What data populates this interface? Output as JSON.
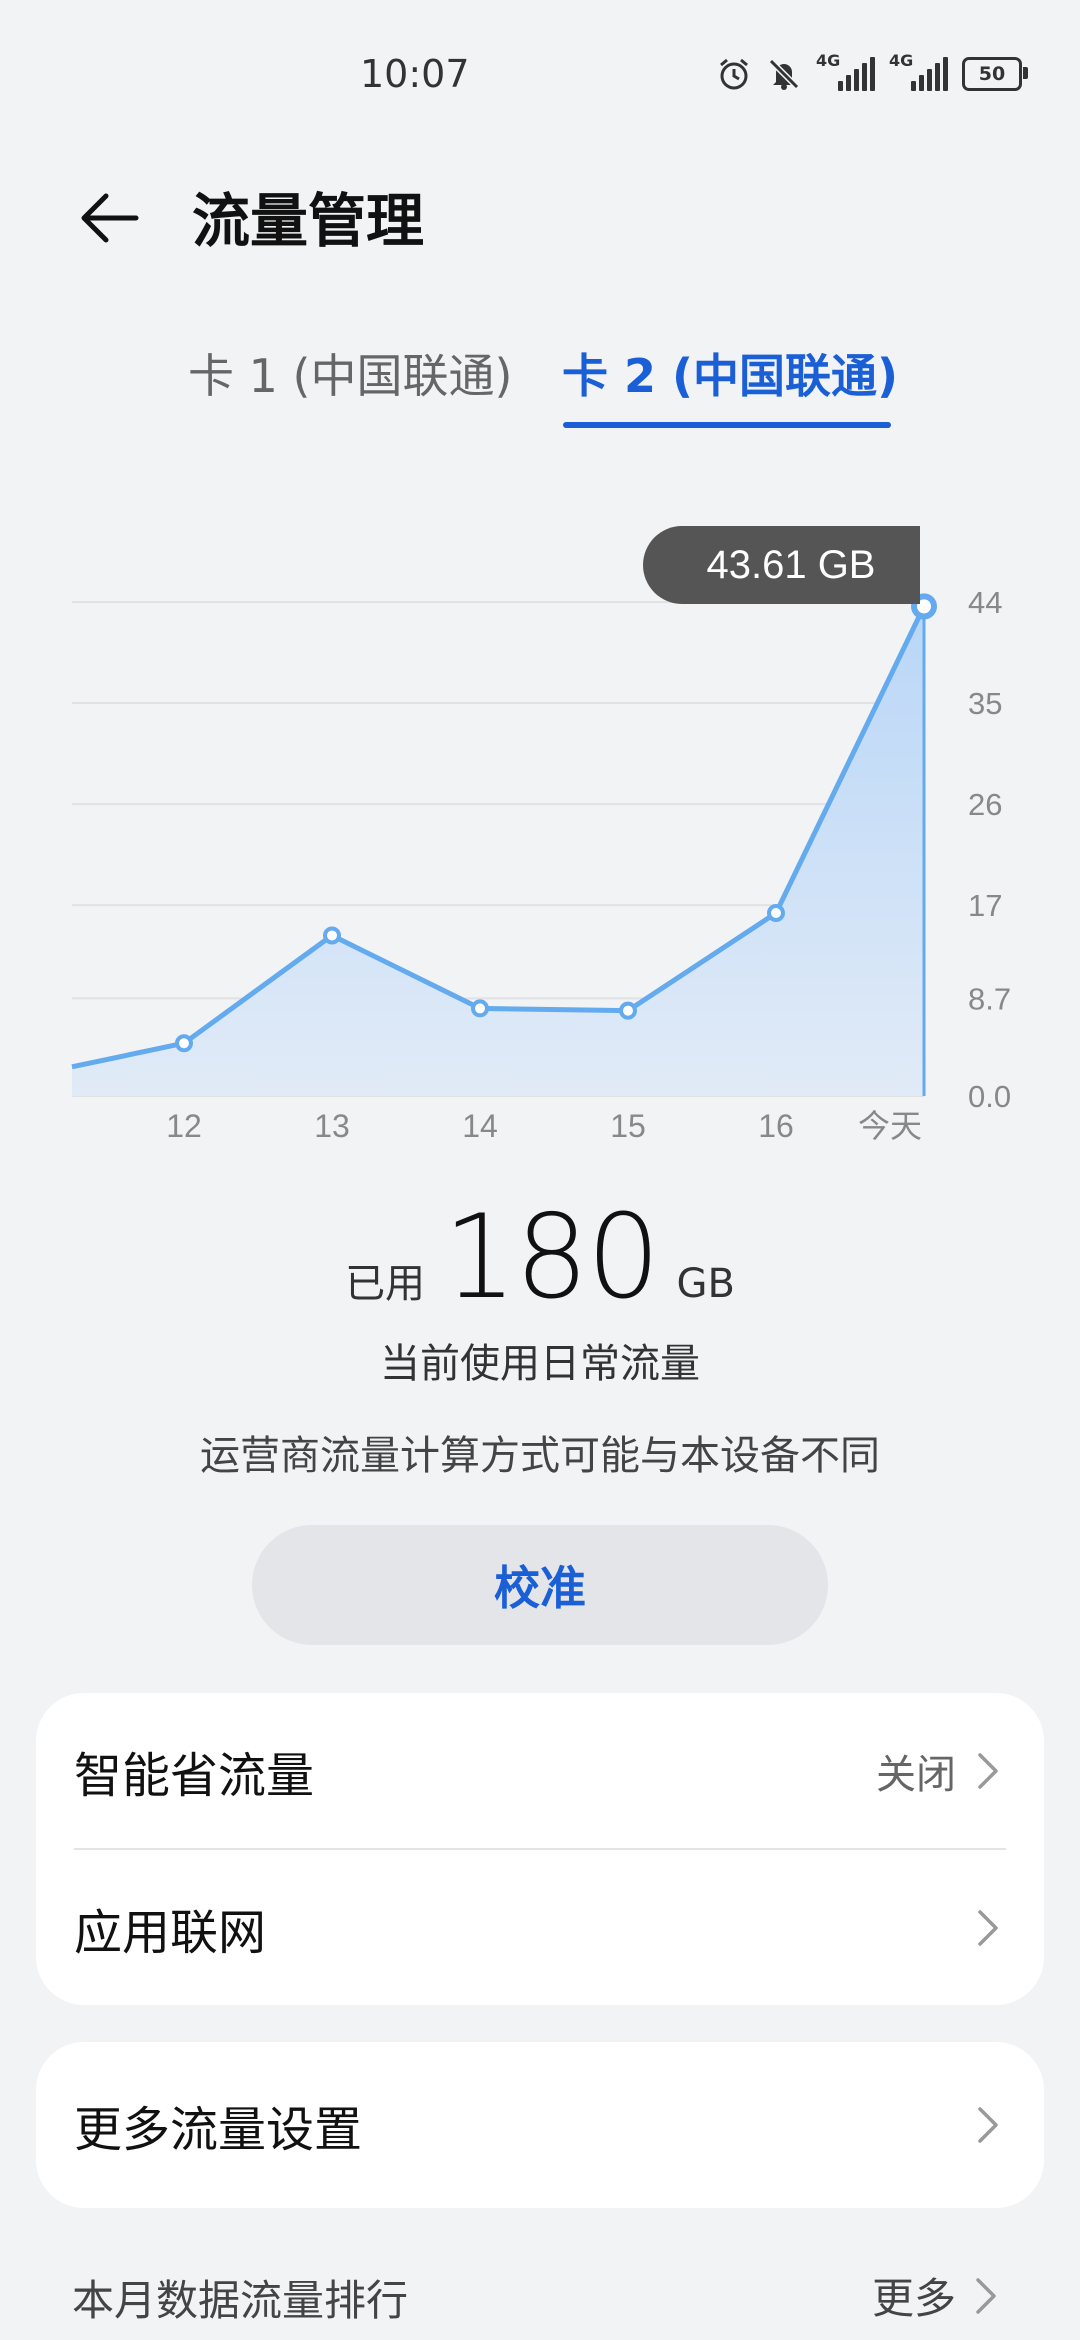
{
  "status_bar": {
    "time": "10:07",
    "icons": [
      "alarm-icon",
      "mute-icon",
      "signal-4g-icon",
      "signal-4g-icon",
      "battery-icon"
    ],
    "network_1": "4G",
    "network_2": "4G",
    "battery": "50"
  },
  "header": {
    "title": "流量管理"
  },
  "tabs": [
    {
      "label": "卡 1 (中国联通)",
      "active": false
    },
    {
      "label": "卡 2 (中国联通)",
      "active": true
    }
  ],
  "colors": {
    "accent": "#1a5fd6",
    "line": "#64aaee",
    "fill": "#cfe2f8",
    "tooltip_bg": "#555555"
  },
  "chart_data": {
    "type": "area",
    "categories": [
      "",
      "12",
      "13",
      "14",
      "15",
      "16",
      "今天"
    ],
    "values": [
      2.6,
      4.7,
      14.3,
      7.8,
      7.6,
      16.3,
      43.61
    ],
    "yticks": [
      "44",
      "35",
      "26",
      "17",
      "8.7",
      "0.0"
    ],
    "ytick_values": [
      44,
      35,
      26,
      17,
      8.7,
      0
    ],
    "ylim": [
      0,
      44
    ],
    "grid": true,
    "highlight": {
      "index": 6,
      "label": "43.61 GB"
    }
  },
  "usage": {
    "label": "已用",
    "value": "180",
    "unit": "GB",
    "mode": "当前使用日常流量",
    "note": "运营商流量计算方式可能与本设备不同"
  },
  "calibrate_label": "校准",
  "settings": {
    "smart_saver": {
      "label": "智能省流量",
      "value": "关闭"
    },
    "app_network": {
      "label": "应用联网"
    },
    "more_settings": {
      "label": "更多流量设置"
    }
  },
  "ranking": {
    "title": "本月数据流量排行",
    "more": "更多"
  }
}
